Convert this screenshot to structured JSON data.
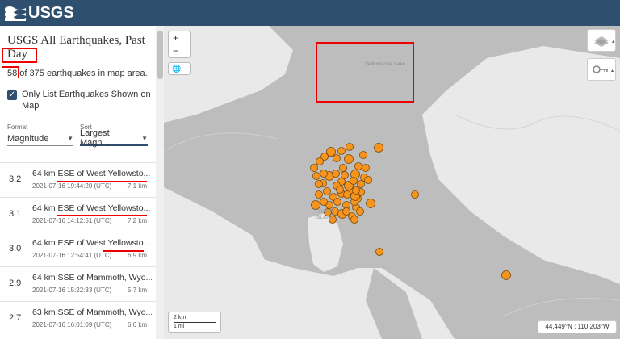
{
  "header": {
    "logo_text": "USGS"
  },
  "feed": {
    "title": "USGS All Earthquakes, Past Day",
    "shown_count": "58",
    "count_suffix": " of 375 earthquakes in map area.",
    "only_list_label": "Only List Earthquakes Shown on Map",
    "only_list_checked": true
  },
  "controls": {
    "format_label": "Format",
    "format_value": "Magnitude",
    "sort_label": "Sort",
    "sort_value": "Largest Magn..."
  },
  "earthquakes": [
    {
      "mag": "3.2",
      "place": "64 km ESE of West Yellowsto...",
      "time": "2021-07-16 19:44:20 (UTC)",
      "depth": "7.1 km"
    },
    {
      "mag": "3.1",
      "place": "64 km ESE of West Yellowsto...",
      "time": "2021-07-16 14:12:51 (UTC)",
      "depth": "7.2 km"
    },
    {
      "mag": "3.0",
      "place": "64 km ESE of West Yellowsto...",
      "time": "2021-07-16 12:54:41 (UTC)",
      "depth": "6.9 km"
    },
    {
      "mag": "2.9",
      "place": "64 km SSE of Mammoth, Wyo...",
      "time": "2021-07-16 15:22:33 (UTC)",
      "depth": "5.7 km"
    },
    {
      "mag": "2.7",
      "place": "63 km SSE of Mammoth, Wyo...",
      "time": "2021-07-16 16:01:09 (UTC)",
      "depth": "6.6 km"
    }
  ],
  "map": {
    "zoom_in": "+",
    "zoom_out": "−",
    "lake_label": "Yellowstone Lake",
    "island_label": "FRANK ISLAND",
    "scale_km": "2 km",
    "scale_mi": "1 mi",
    "coordinates": "44.449°N : 110.203°W",
    "marker_color": "#f7941d",
    "water_color": "#bdbdbd",
    "land_color": "#e9e9e9",
    "annotation_color": "#e00000"
  }
}
